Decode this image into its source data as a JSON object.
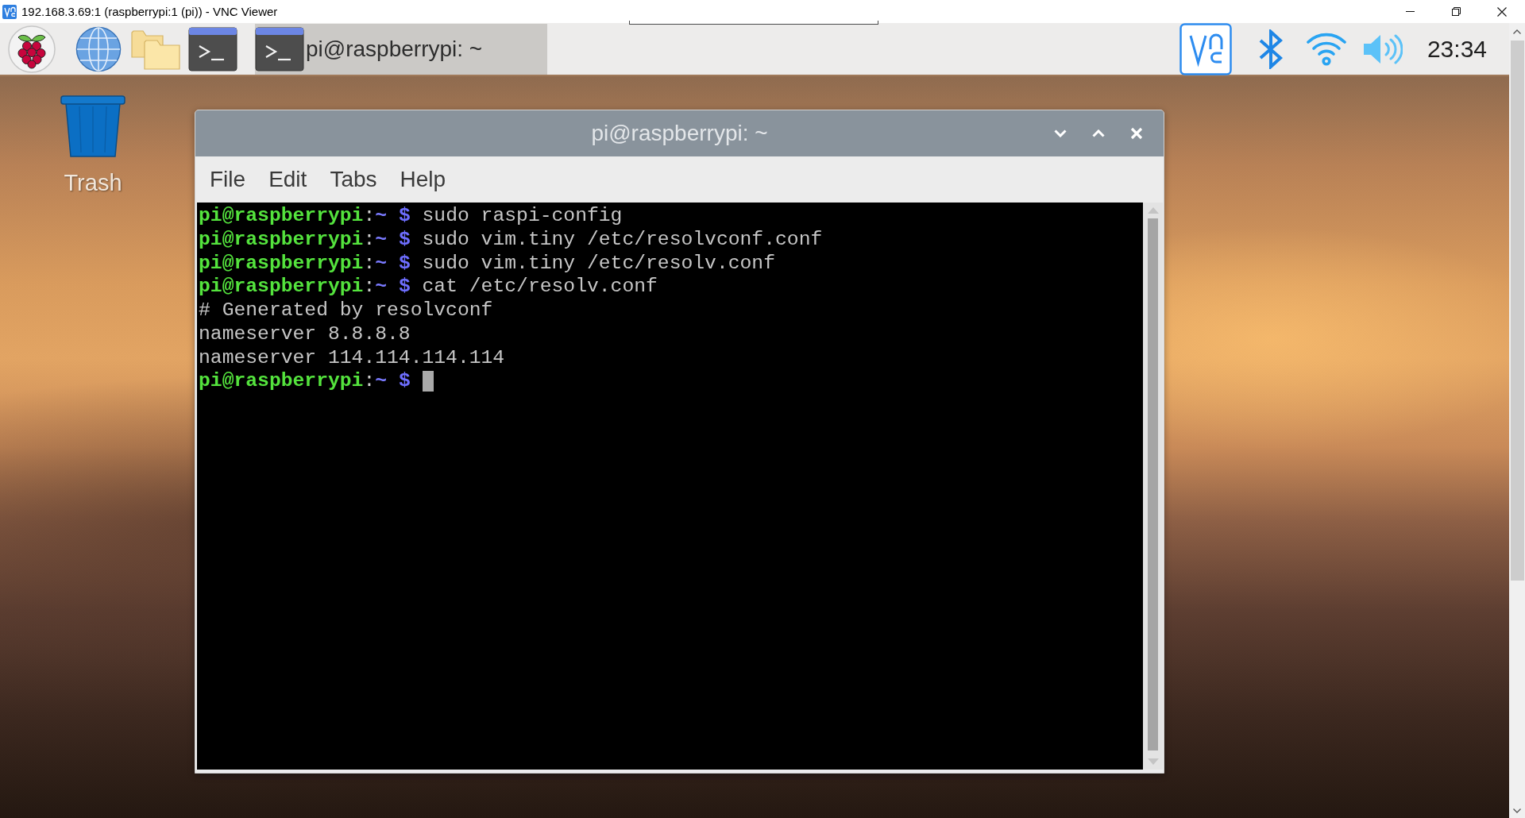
{
  "viewer_window": {
    "title": "192.168.3.69:1 (raspberrypi:1 (pi)) - VNC Viewer"
  },
  "taskbar": {
    "tasks": [
      {
        "label": "pi@raspberrypi: ~",
        "selected": true
      }
    ],
    "clock": "23:34"
  },
  "desktop": {
    "icons": [
      {
        "label": "Trash"
      }
    ]
  },
  "terminal_window": {
    "title": "pi@raspberrypi: ~",
    "menu": [
      "File",
      "Edit",
      "Tabs",
      "Help"
    ],
    "lines": [
      {
        "kind": "prompt",
        "user_host": "pi@raspberrypi",
        "separator": ":",
        "path": "~",
        "symbol": "$",
        "command": "sudo raspi-config",
        "cursor": false
      },
      {
        "kind": "prompt",
        "user_host": "pi@raspberrypi",
        "separator": ":",
        "path": "~",
        "symbol": "$",
        "command": "sudo vim.tiny /etc/resolvconf.conf",
        "cursor": false
      },
      {
        "kind": "prompt",
        "user_host": "pi@raspberrypi",
        "separator": ":",
        "path": "~",
        "symbol": "$",
        "command": "sudo vim.tiny /etc/resolv.conf",
        "cursor": false
      },
      {
        "kind": "prompt",
        "user_host": "pi@raspberrypi",
        "separator": ":",
        "path": "~",
        "symbol": "$",
        "command": "cat /etc/resolv.conf",
        "cursor": false
      },
      {
        "kind": "output",
        "text": "# Generated by resolvconf",
        "cursor": false
      },
      {
        "kind": "output",
        "text": "nameserver 8.8.8.8",
        "cursor": false
      },
      {
        "kind": "output",
        "text": "nameserver 114.114.114.114",
        "cursor": false
      },
      {
        "kind": "prompt",
        "user_host": "pi@raspberrypi",
        "separator": ":",
        "path": "~",
        "symbol": "$",
        "cursor": true
      }
    ]
  }
}
